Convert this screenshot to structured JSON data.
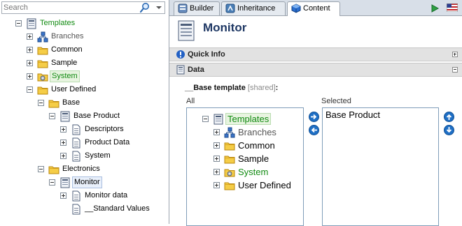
{
  "search": {
    "placeholder": "Search"
  },
  "tree": [
    {
      "label": "Templates",
      "style": "green",
      "icon": "template-icon",
      "expander": "minus"
    },
    {
      "label": "Branches",
      "style": "gray",
      "icon": "branch-icon",
      "expander": "plus"
    },
    {
      "label": "Common",
      "style": "normal",
      "icon": "folder-icon",
      "expander": "plus"
    },
    {
      "label": "Sample",
      "style": "normal",
      "icon": "folder-icon",
      "expander": "plus"
    },
    {
      "label": "System",
      "style": "green-hl",
      "icon": "system-folder-icon",
      "expander": "plus"
    },
    {
      "label": "User Defined",
      "style": "normal",
      "icon": "folder-icon",
      "expander": "minus"
    },
    {
      "label": "Base",
      "style": "normal",
      "icon": "folder-icon",
      "expander": "minus"
    },
    {
      "label": "Base Product",
      "style": "normal",
      "icon": "template-icon",
      "expander": "minus"
    },
    {
      "label": "Descriptors",
      "style": "normal",
      "icon": "document-icon",
      "expander": "plus"
    },
    {
      "label": "Product Data",
      "style": "normal",
      "icon": "document-icon",
      "expander": "plus"
    },
    {
      "label": "System",
      "style": "normal",
      "icon": "document-icon",
      "expander": "plus"
    },
    {
      "label": "Electronics",
      "style": "normal",
      "icon": "folder-icon",
      "expander": "minus"
    },
    {
      "label": "Monitor",
      "style": "selected",
      "icon": "template-icon",
      "expander": "minus"
    },
    {
      "label": "Monitor data",
      "style": "normal",
      "icon": "document-icon",
      "expander": "plus"
    },
    {
      "label": "__Standard Values",
      "style": "normal",
      "icon": "document-icon",
      "expander": "none"
    }
  ],
  "tabs": [
    {
      "label": "Builder",
      "icon": "builder-icon",
      "active": false
    },
    {
      "label": "Inheritance",
      "icon": "inheritance-icon",
      "active": false
    },
    {
      "label": "Content",
      "icon": "content-cube-icon",
      "active": true
    }
  ],
  "item": {
    "title": "Monitor",
    "icon": "template-icon"
  },
  "sections": {
    "quick_info": {
      "label": "Quick Info",
      "icon": "info-icon",
      "collapsed": true
    },
    "data": {
      "label": "Data",
      "icon": "data-icon",
      "collapsed": false
    }
  },
  "field": {
    "name": "__Base template",
    "shared": "[shared]",
    "colon": ":",
    "all_label": "All",
    "selected_label": "Selected",
    "all_tree": [
      {
        "label": "Templates",
        "style": "green-hl",
        "icon": "template-icon",
        "expander": "minus"
      },
      {
        "label": "Branches",
        "style": "gray",
        "icon": "branch-icon",
        "expander": "plus"
      },
      {
        "label": "Common",
        "style": "normal",
        "icon": "folder-icon",
        "expander": "plus"
      },
      {
        "label": "Sample",
        "style": "normal",
        "icon": "folder-icon",
        "expander": "plus"
      },
      {
        "label": "System",
        "style": "green",
        "icon": "system-folder-icon",
        "expander": "plus"
      },
      {
        "label": "User Defined",
        "style": "normal",
        "icon": "folder-icon",
        "expander": "plus"
      }
    ],
    "selected_items": [
      "Base Product"
    ]
  },
  "colors": {
    "accent": "#1f6fc5",
    "title": "#1f3864",
    "green": "#108a10"
  }
}
